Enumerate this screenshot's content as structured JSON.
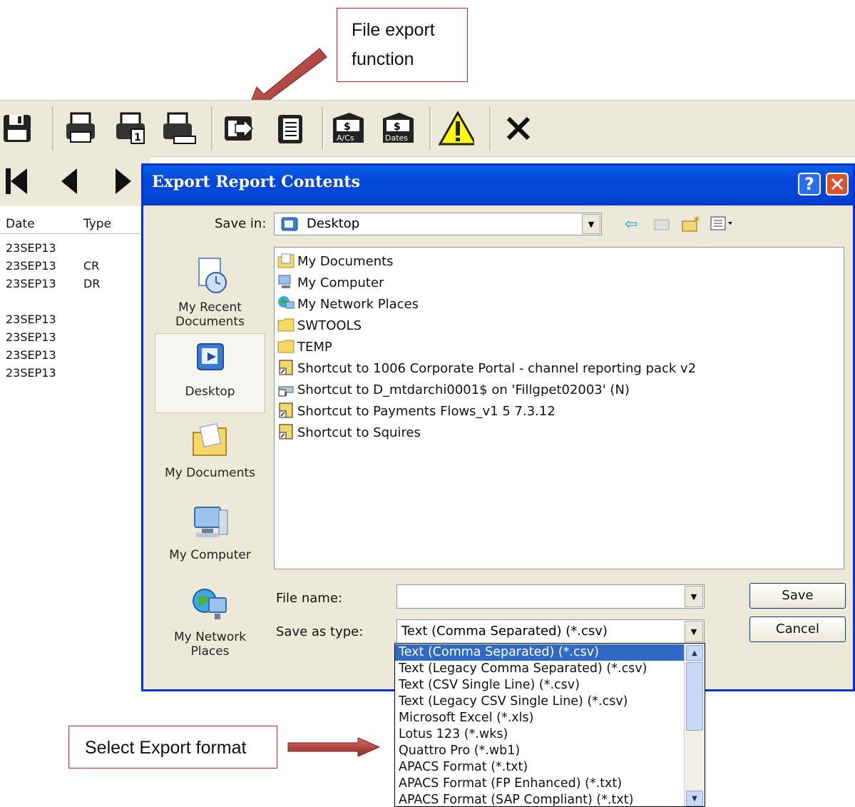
{
  "annotations": {
    "top_line1": "File export",
    "top_line2": "function",
    "bottom": "Select Export format"
  },
  "toolbar": {
    "icons": [
      "save-icon",
      "print-icon",
      "print-one-icon",
      "print-preview-icon",
      "export-icon",
      "copy-icon",
      "accounts-icon",
      "dates-icon",
      "warning-icon",
      "close-icon"
    ],
    "accounts_label": "A/Cs",
    "dates_label": "Dates"
  },
  "report": {
    "headers": [
      "Date",
      "Type"
    ],
    "rows": [
      {
        "date": "23SEP13",
        "type": ""
      },
      {
        "date": "23SEP13",
        "type": "CR"
      },
      {
        "date": "23SEP13",
        "type": "DR"
      },
      {
        "date": "23SEP13",
        "type": ""
      },
      {
        "date": "23SEP13",
        "type": ""
      },
      {
        "date": "23SEP13",
        "type": ""
      },
      {
        "date": "23SEP13",
        "type": ""
      }
    ]
  },
  "dialog": {
    "title": "Export Report Contents",
    "help": "?",
    "save_in_label": "Save in:",
    "save_in_value": "Desktop",
    "places": [
      "My Recent Documents",
      "Desktop",
      "My Documents",
      "My Computer",
      "My Network Places"
    ],
    "places_lines": [
      [
        "My Recent",
        "Documents"
      ],
      [
        "Desktop"
      ],
      [
        "My Documents"
      ],
      [
        "My Computer"
      ],
      [
        "My Network",
        "Places"
      ]
    ],
    "files": [
      "My Documents",
      "My Computer",
      "My Network Places",
      "SWTOOLS",
      "TEMP",
      "Shortcut to 1006 Corporate Portal - channel reporting pack v2",
      "Shortcut to D_mtdarchi0001$ on 'Fillgpet02003' (N)",
      "Shortcut to Payments Flows_v1 5 7.3.12",
      "Shortcut to Squires"
    ],
    "file_name_label": "File name:",
    "file_name_value": "",
    "save_type_label": "Save as type:",
    "save_type_value": "Text (Comma Separated) (*.csv)",
    "save_button": "Save",
    "cancel_button": "Cancel",
    "type_options": [
      "Text (Comma Separated) (*.csv)",
      "Text (Legacy Comma Separated) (*.csv)",
      "Text (CSV Single Line) (*.csv)",
      "Text (Legacy CSV Single Line) (*.csv)",
      "Microsoft Excel (*.xls)",
      "Lotus 123 (*.wks)",
      "Quattro Pro (*.wb1)",
      "APACS Format (*.txt)",
      "APACS Format (FP Enhanced) (*.txt)",
      "APACS Format (SAP Compliant) (*.txt)"
    ]
  }
}
